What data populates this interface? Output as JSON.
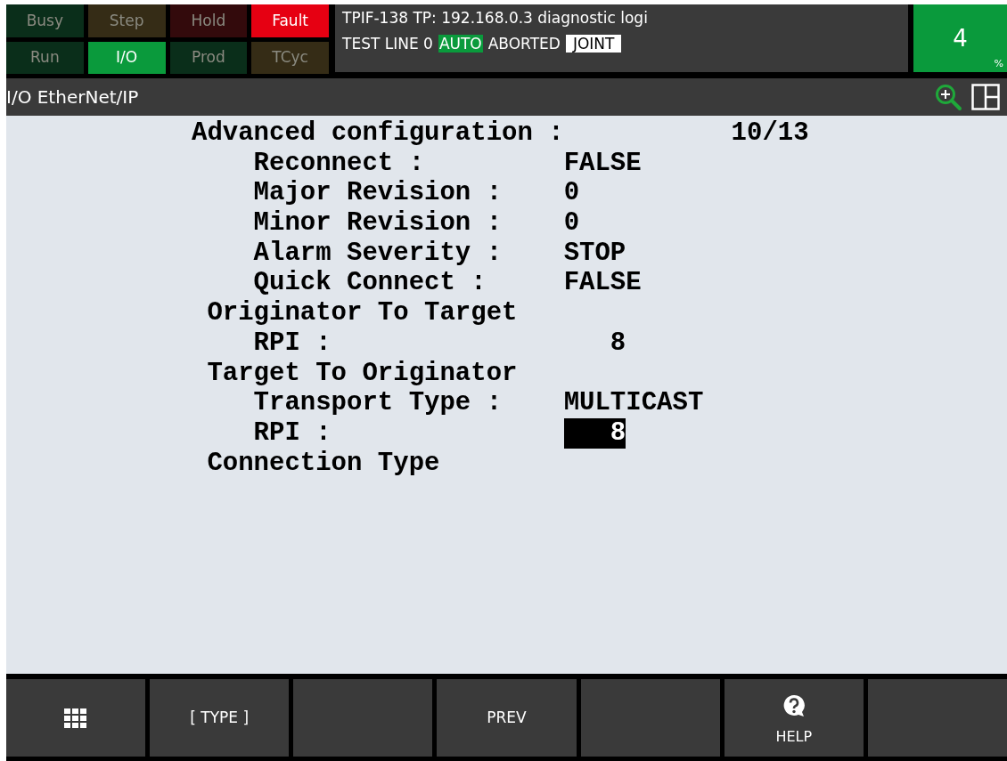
{
  "status_lamps": [
    {
      "label": "Busy",
      "on": false,
      "color": "#0a2e1a"
    },
    {
      "label": "Step",
      "on": false,
      "color": "#352c16"
    },
    {
      "label": "Hold",
      "on": false,
      "color": "#330a0c"
    },
    {
      "label": "Fault",
      "on": true,
      "color": "#e60012"
    },
    {
      "label": "Run",
      "on": false,
      "color": "#0a2e1a"
    },
    {
      "label": "I/O",
      "on": true,
      "color": "#0a9a3c"
    },
    {
      "label": "Prod",
      "on": false,
      "color": "#0a2e1a"
    },
    {
      "label": "TCyc",
      "on": false,
      "color": "#352c16"
    }
  ],
  "message": "TPIF-138 TP: 192.168.0.3 diagnostic logi",
  "status_line": [
    {
      "text": "TEST LINE 0",
      "kind": "plain"
    },
    {
      "text": "AUTO",
      "kind": "green"
    },
    {
      "text": "ABORTED",
      "kind": "plain"
    },
    {
      "text": "JOINT",
      "kind": "inverse"
    }
  ],
  "override": {
    "value": "4",
    "unit": "%"
  },
  "screen_title": "I/O EtherNet/IP",
  "content": {
    "heading": "Advanced configuration :",
    "page": "10/13",
    "items": [
      {
        "label": "Reconnect :",
        "value": "FALSE",
        "kind": "text",
        "selected": false
      },
      {
        "label": "Major Revision :",
        "value": "0",
        "kind": "text",
        "selected": false
      },
      {
        "label": "Minor Revision :",
        "value": "0",
        "kind": "text",
        "selected": false
      },
      {
        "label": "Alarm Severity :",
        "value": "STOP",
        "kind": "text",
        "selected": false
      },
      {
        "label": "Quick Connect :",
        "value": "FALSE",
        "kind": "text",
        "selected": false
      },
      {
        "label": "Originator To Target",
        "children": [
          {
            "label": "RPI :",
            "value": "8",
            "kind": "numeric",
            "selected": false
          }
        ]
      },
      {
        "label": "Target To Originator",
        "children": [
          {
            "label": "Transport Type :",
            "value": "MULTICAST",
            "kind": "text",
            "selected": false
          },
          {
            "label": "RPI :",
            "value": "8",
            "kind": "numeric",
            "selected": true
          }
        ]
      },
      {
        "label": "Connection Type"
      }
    ]
  },
  "softkeys": [
    {
      "kind": "menu"
    },
    {
      "kind": "text",
      "label": "[ TYPE ]"
    },
    {
      "kind": "blank"
    },
    {
      "kind": "text",
      "label": "PREV"
    },
    {
      "kind": "blank"
    },
    {
      "kind": "help",
      "label": "HELP"
    },
    {
      "kind": "blank"
    }
  ]
}
